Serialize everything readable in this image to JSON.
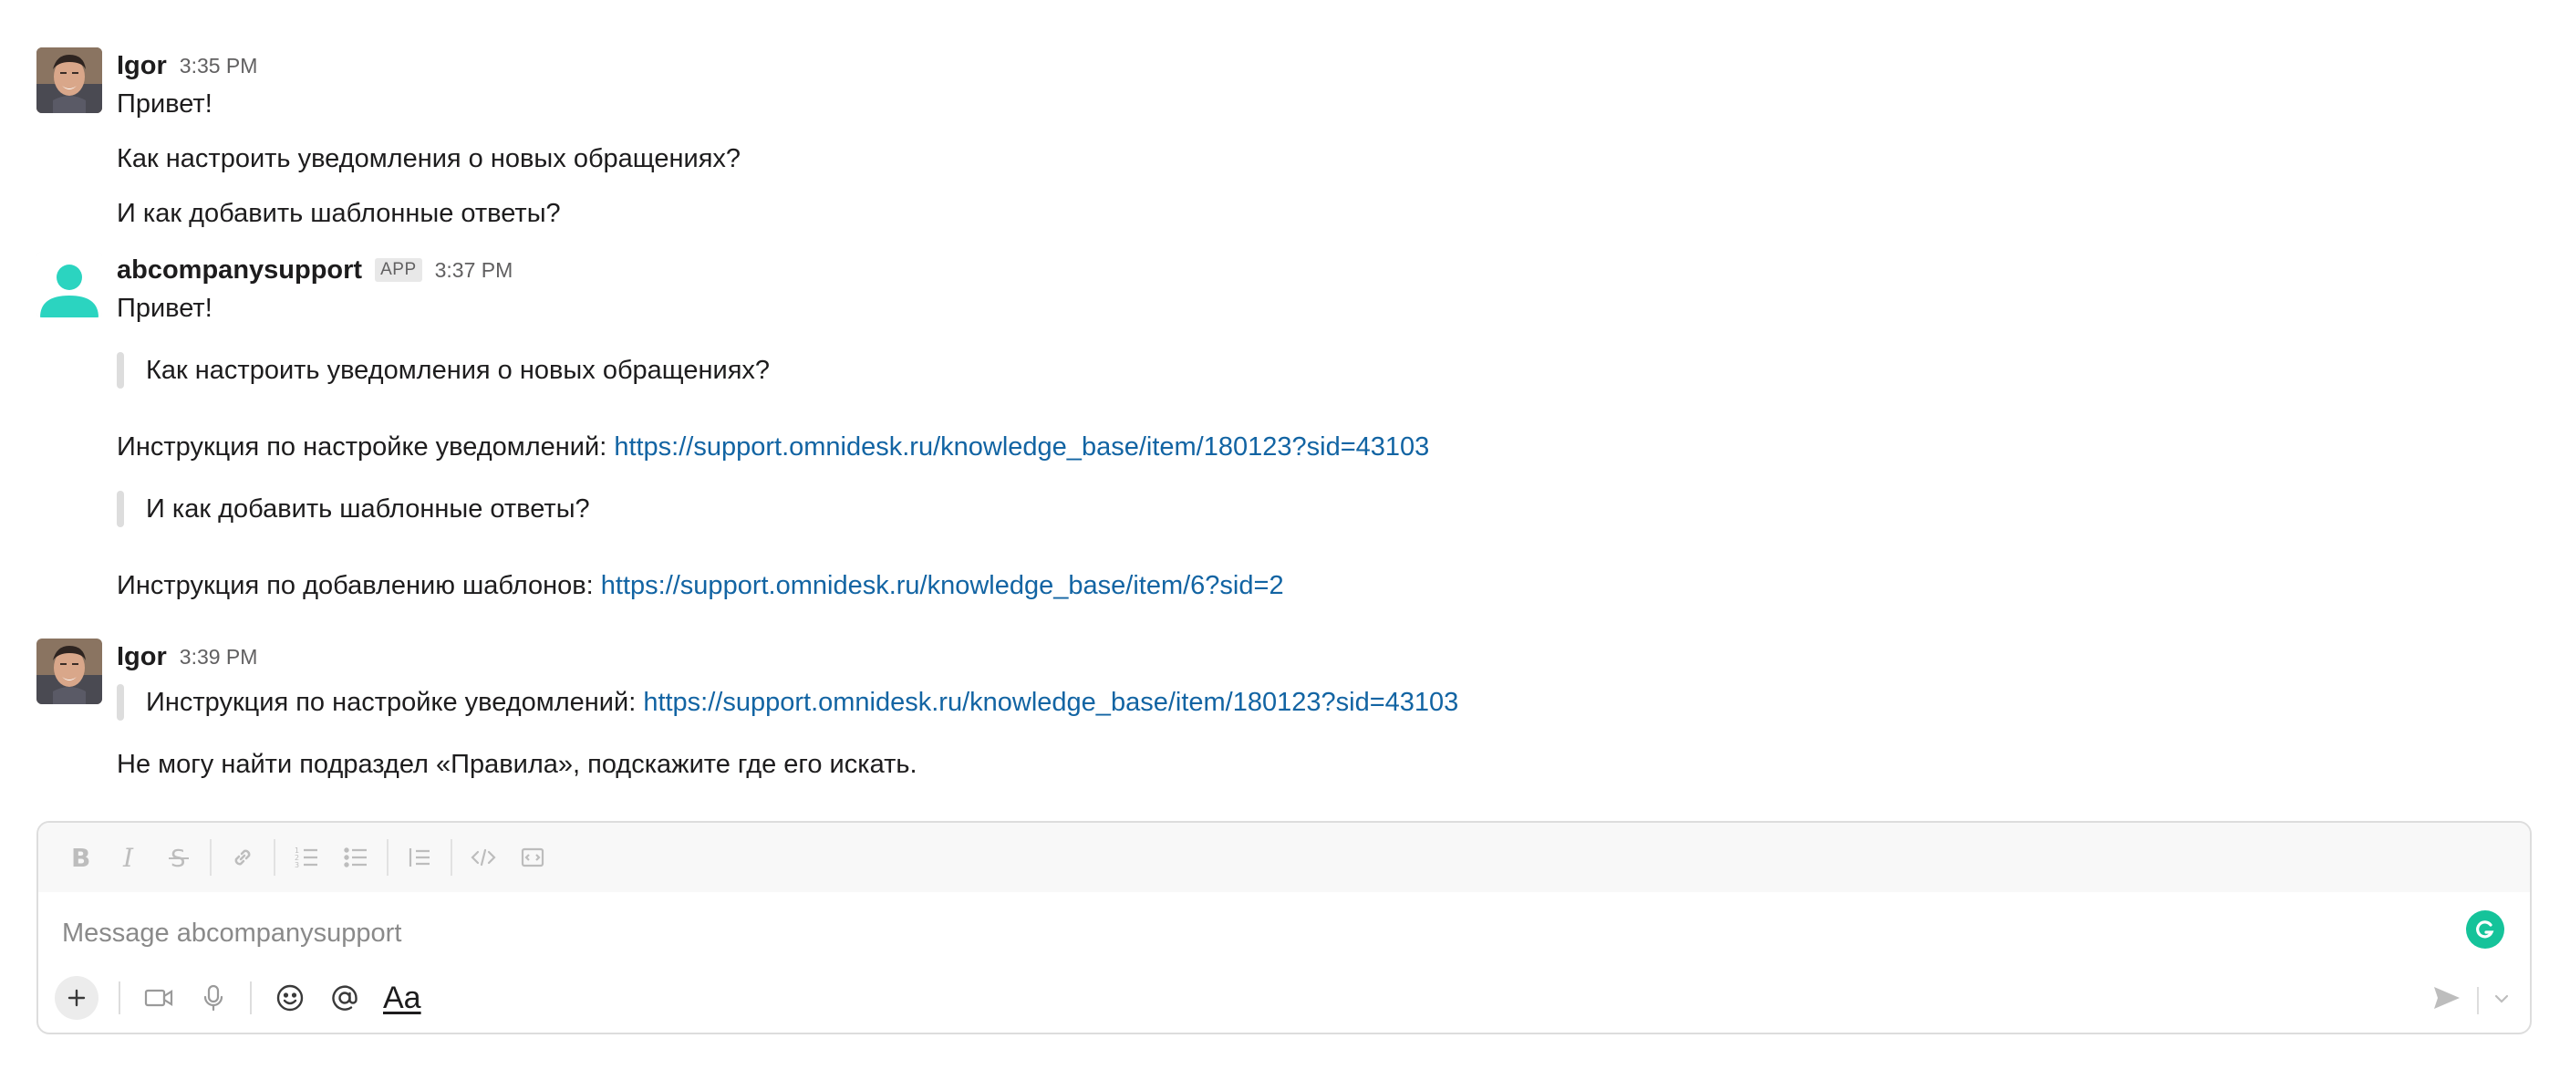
{
  "messages": [
    {
      "author": "Igor",
      "time": "3:35 PM",
      "lines": [
        "Привет!",
        "Как настроить уведомления о новых обращениях?",
        "И как добавить шаблонные ответы?"
      ]
    },
    {
      "author": "abcompanysupport",
      "badge": "APP",
      "time": "3:37 PM",
      "greeting": "Привет!",
      "quote1": "Как настроить уведомления о новых обращениях?",
      "instr1_text": "Инструкция по настройке уведомлений: ",
      "instr1_link": "https://support.omnidesk.ru/knowledge_base/item/180123?sid=43103",
      "quote2": "И как добавить шаблонные ответы?",
      "instr2_text": "Инструкция по добавлению шаблонов: ",
      "instr2_link": "https://support.omnidesk.ru/knowledge_base/item/6?sid=2"
    },
    {
      "author": "Igor",
      "time": "3:39 PM",
      "quote_text": "Инструкция по настройке уведомлений: ",
      "quote_link": "https://support.omnidesk.ru/knowledge_base/item/180123?sid=43103",
      "text": "Не могу найти подраздел «Правила», подскажите где его искать."
    }
  ],
  "composer": {
    "placeholder": "Message abcompanysupport",
    "format_buttons": [
      "bold-icon",
      "italic-icon",
      "strikethrough-icon",
      "link-icon",
      "ordered-list-icon",
      "bulleted-list-icon",
      "blockquote-icon",
      "code-icon",
      "code-block-icon"
    ],
    "bottom_buttons": [
      "plus-icon",
      "video-icon",
      "microphone-icon",
      "emoji-icon",
      "mention-icon",
      "formatting-icon"
    ],
    "aa_label": "Aa"
  },
  "colors": {
    "link": "#1264a3",
    "bot_avatar": "#2bd4c0",
    "grammarly": "#15c39a"
  }
}
